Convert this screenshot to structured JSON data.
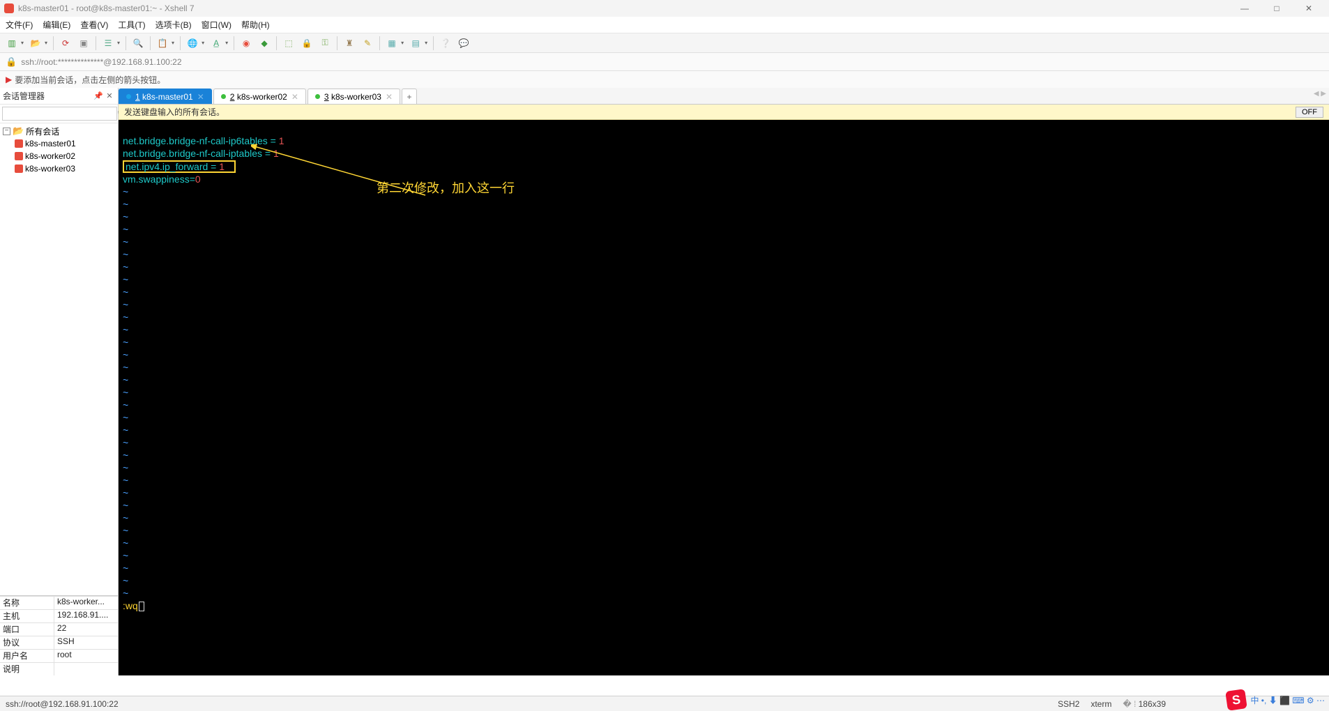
{
  "titlebar": {
    "title": "k8s-master01 - root@k8s-master01:~ - Xshell 7"
  },
  "menu": {
    "file": "文件(F)",
    "edit": "编辑(E)",
    "view": "查看(V)",
    "tools": "工具(T)",
    "tabs": "选项卡(B)",
    "window": "窗口(W)",
    "help": "帮助(H)"
  },
  "addr": {
    "text": "ssh://root:**************@192.168.91.100:22"
  },
  "hint": {
    "text": "要添加当前会话，点击左侧的箭头按钮。"
  },
  "sidebar": {
    "title": "会话管理器",
    "root": "所有会话",
    "items": [
      {
        "label": "k8s-master01"
      },
      {
        "label": "k8s-worker02"
      },
      {
        "label": "k8s-worker03"
      }
    ],
    "props": [
      {
        "k": "名称",
        "v": "k8s-worker..."
      },
      {
        "k": "主机",
        "v": "192.168.91...."
      },
      {
        "k": "端口",
        "v": "22"
      },
      {
        "k": "协议",
        "v": "SSH"
      },
      {
        "k": "用户名",
        "v": "root"
      },
      {
        "k": "说明",
        "v": ""
      }
    ]
  },
  "tabs": [
    {
      "num": "1",
      "label": "k8s-master01",
      "color": "blue",
      "active": true
    },
    {
      "num": "2",
      "label": "k8s-worker02",
      "color": "green",
      "active": false
    },
    {
      "num": "3",
      "label": "k8s-worker03",
      "color": "green",
      "active": false
    }
  ],
  "sendbar": {
    "text": "发送键盘输入的所有会话。",
    "btn": "OFF"
  },
  "terminal": {
    "l1_a": "net.bridge.bridge-nf-call-ip6tables",
    "l1_b": " = ",
    "l1_c": "1",
    "l2_a": "net.bridge.bridge-nf-call-iptables",
    "l2_b": " = ",
    "l2_c": "1",
    "l3_a": "net.ipv4.ip_forward",
    "l3_b": " = ",
    "l3_c": "1",
    "l4_a": "vm.swappiness",
    "l4_b": "=",
    "l4_c": "0",
    "wq": ":wq",
    "annot": "第二次修改，加入这一行"
  },
  "status": {
    "left": "ssh://root@192.168.91.100:22",
    "ssh": "SSH2",
    "term": "xterm",
    "size": "186x39",
    "tray": "中 •, ⬇  ⬛ ⌨ ⚙ ⋯"
  }
}
